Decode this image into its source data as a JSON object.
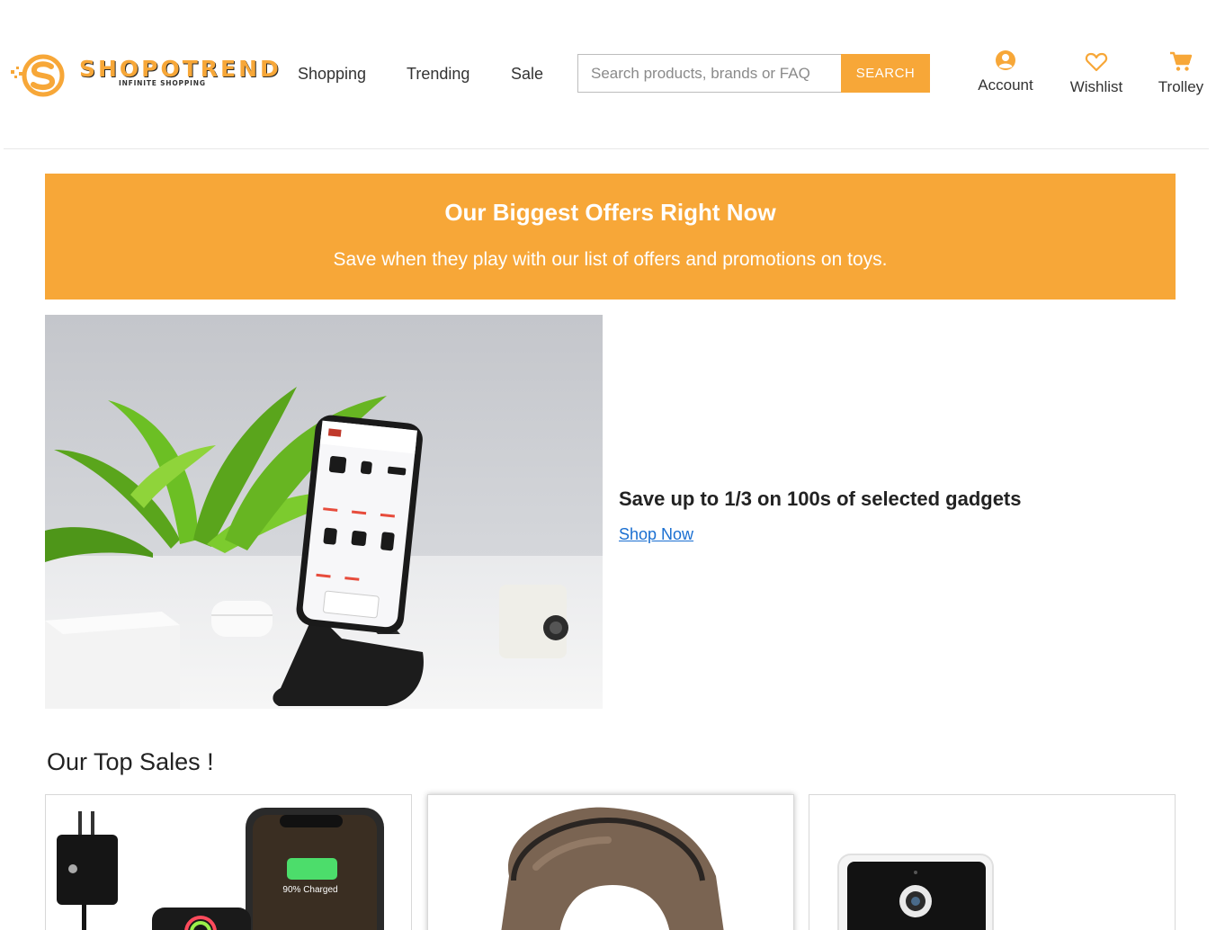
{
  "brand": {
    "name": "SHOPOTREND",
    "tagline": "INFINITE SHOPPING",
    "accent_color": "#f7a738"
  },
  "nav": {
    "items": [
      {
        "label": "Shopping"
      },
      {
        "label": "Trending"
      },
      {
        "label": "Sale"
      }
    ]
  },
  "search": {
    "placeholder": "Search products, brands or FAQ",
    "value": "",
    "button_label": "SEARCH"
  },
  "header_actions": [
    {
      "label": "Account",
      "icon": "account-icon"
    },
    {
      "label": "Wishlist",
      "icon": "heart-icon"
    },
    {
      "label": "Trolley",
      "icon": "cart-icon"
    }
  ],
  "banner": {
    "title": "Our Biggest Offers Right Now",
    "subtitle": "Save when they play with our list of offers and promotions on toys."
  },
  "promo": {
    "title": "Save up to 1/3 on 100s of selected gadgets",
    "link_label": "Shop Now",
    "image_icon": "phone-on-stand-image"
  },
  "top_sales": {
    "title": "Our Top Sales !",
    "cards": [
      {
        "image_icon": "charger-and-phone-image",
        "image_text": "90% Charged"
      },
      {
        "image_icon": "travel-pillow-image"
      },
      {
        "image_icon": "security-camera-image"
      }
    ]
  }
}
